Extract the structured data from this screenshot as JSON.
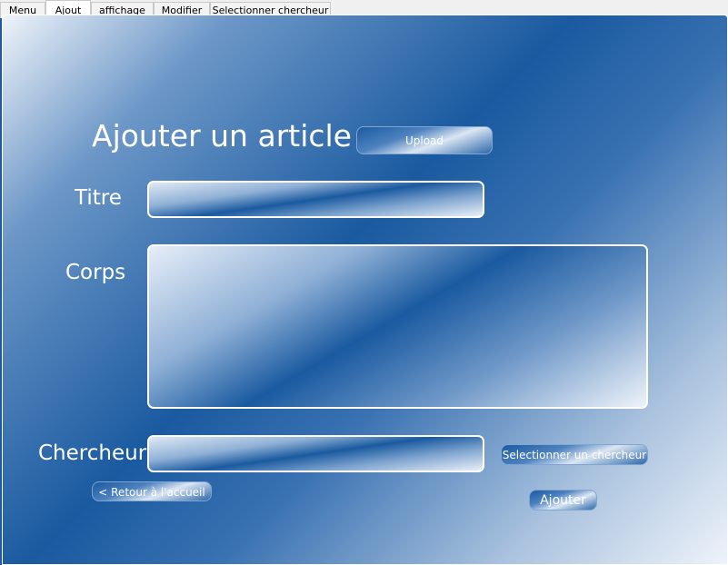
{
  "tabs": [
    "Menu",
    "Ajout",
    "affichage",
    "Modifier",
    "Selectionner chercheur"
  ],
  "active_tab": "Ajout",
  "form": {
    "heading": "Ajouter un article",
    "upload_label": "Upload",
    "titre_label": "Titre",
    "titre_value": "",
    "corps_label": "Corps",
    "corps_value": "",
    "chercheur_label": "Chercheur",
    "chercheur_value": "",
    "select_chercheur_label": "Selectionner un chercheur",
    "back_label": "< Retour à l'accueil",
    "submit_label": "Ajouter"
  }
}
